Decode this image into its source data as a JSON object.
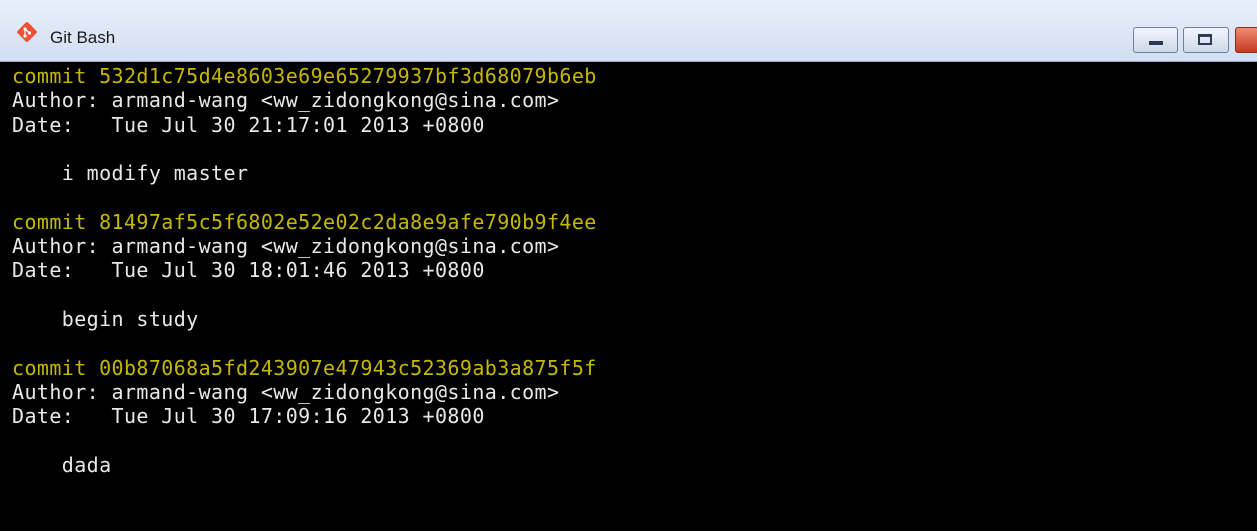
{
  "window": {
    "title": "Git Bash",
    "icon": "git-logo-icon",
    "accent_color": "#f05033"
  },
  "terminal": {
    "commit_color": "#c6b800",
    "text_color": "#e8e8e8",
    "lines": [
      {
        "text": "commit 532d1c75d4e8603e69e65279937bf3d68079b6eb",
        "style": "yellow"
      },
      {
        "text": "Author: armand-wang <ww_zidongkong@sina.com>",
        "style": "white"
      },
      {
        "text": "Date:   Tue Jul 30 21:17:01 2013 +0800",
        "style": "white"
      },
      {
        "text": "",
        "style": "white"
      },
      {
        "text": "    i modify master",
        "style": "white"
      },
      {
        "text": "",
        "style": "white"
      },
      {
        "text": "commit 81497af5c5f6802e52e02c2da8e9afe790b9f4ee",
        "style": "yellow"
      },
      {
        "text": "Author: armand-wang <ww_zidongkong@sina.com>",
        "style": "white"
      },
      {
        "text": "Date:   Tue Jul 30 18:01:46 2013 +0800",
        "style": "white"
      },
      {
        "text": "",
        "style": "white"
      },
      {
        "text": "    begin study",
        "style": "white"
      },
      {
        "text": "",
        "style": "white"
      },
      {
        "text": "commit 00b87068a5fd243907e47943c52369ab3a875f5f",
        "style": "yellow"
      },
      {
        "text": "Author: armand-wang <ww_zidongkong@sina.com>",
        "style": "white"
      },
      {
        "text": "Date:   Tue Jul 30 17:09:16 2013 +0800",
        "style": "white"
      },
      {
        "text": "",
        "style": "white"
      },
      {
        "text": "    dada",
        "style": "white"
      }
    ]
  }
}
